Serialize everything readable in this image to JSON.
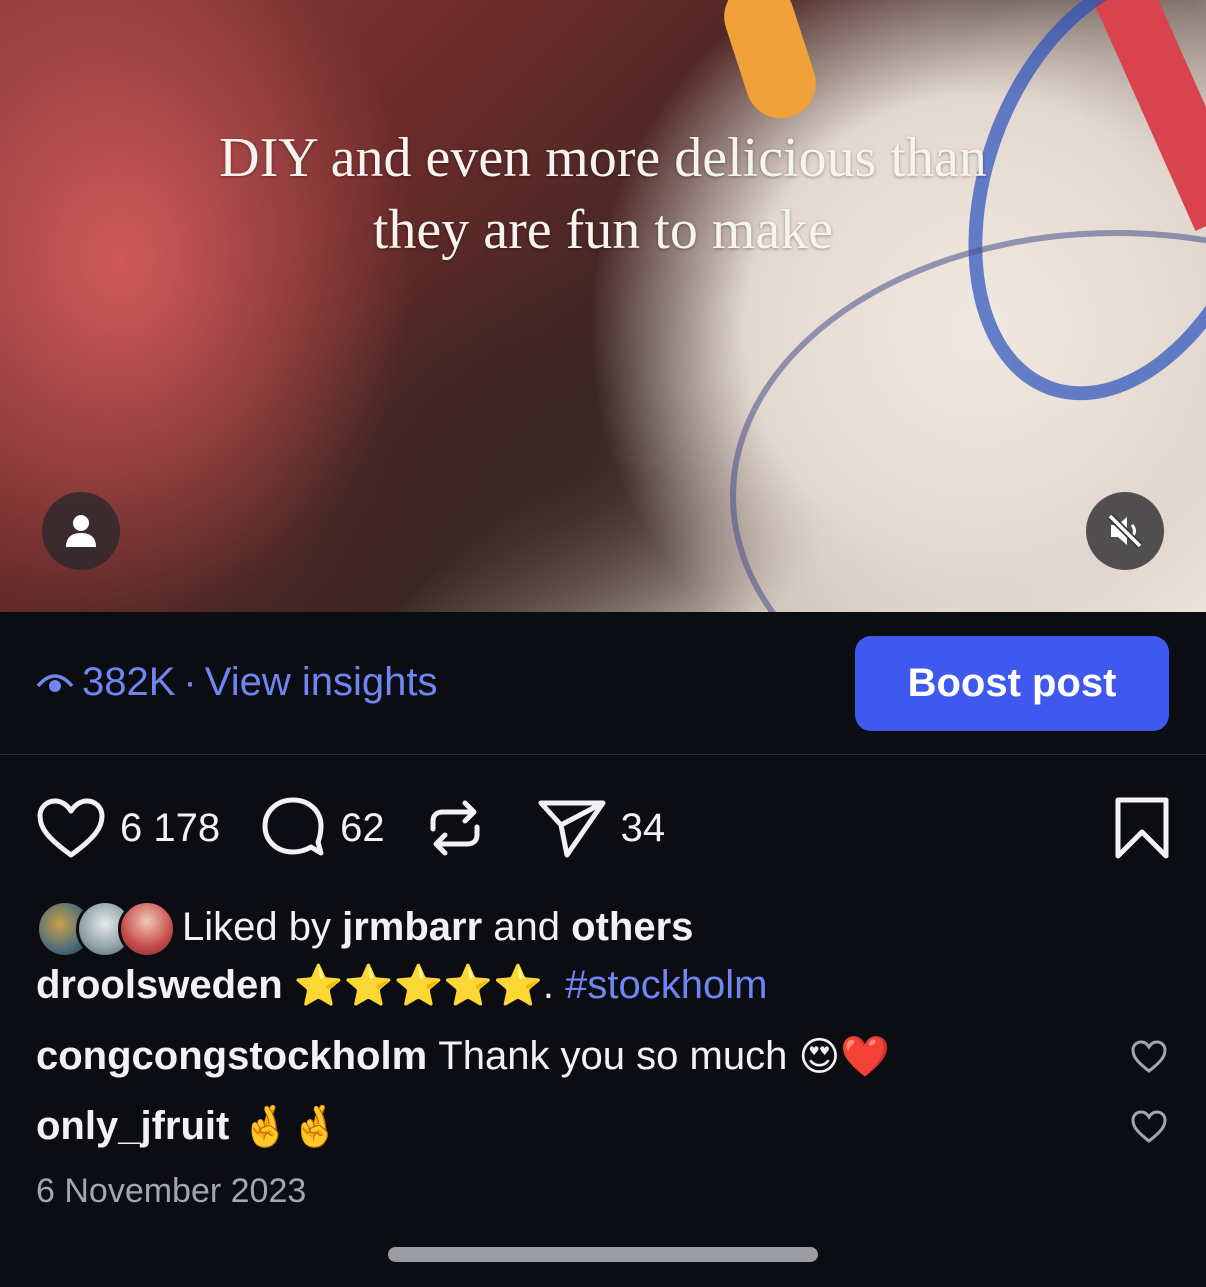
{
  "media": {
    "caption_line1": "DIY and even more delicious than",
    "caption_line2": "they are fun to make"
  },
  "insights": {
    "views": "382K",
    "separator": "·",
    "link_label": "View insights",
    "boost_label": "Boost post"
  },
  "actions": {
    "likes": "6 178",
    "comments": "62",
    "shares": "34"
  },
  "liked_by": {
    "prefix": "Liked by",
    "user": "jrmbarr",
    "middle": "and",
    "suffix": "others"
  },
  "caption": {
    "username": "droolsweden",
    "stars": "⭐⭐⭐⭐⭐",
    "dot": ".",
    "hashtag": "#stockholm"
  },
  "comments": [
    {
      "username": "congcongstockholm",
      "text": "Thank you so much",
      "emoji": "😍❤️"
    },
    {
      "username": "only_jfruit",
      "text": "",
      "emoji": "🤞🤞"
    }
  ],
  "date": "6 November 2023",
  "colors": {
    "accent": "#3f58ee",
    "link": "#6f86f2",
    "background": "#0c0d12"
  }
}
